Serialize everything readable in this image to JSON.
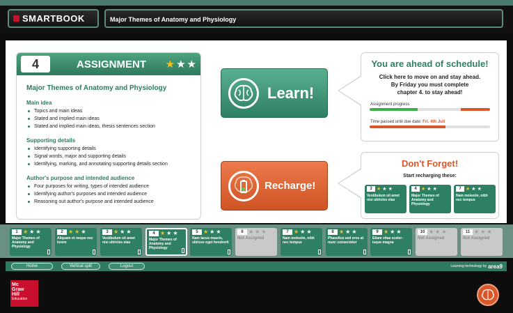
{
  "app": {
    "brand": "SMARTBOOK",
    "chapter_title": "Major Themes of Anatomy and Physiology"
  },
  "assignment": {
    "number": "4",
    "label": "ASSIGNMENT",
    "stars_gold": 1,
    "title": "Major Themes of Anatomy and Physiology",
    "sections": [
      {
        "title": "Main idea",
        "items": [
          "Topics and main ideas",
          "Stated and implied main ideas",
          "Stated and implied main ideas, thesis sentences section"
        ]
      },
      {
        "title": "Supporting details",
        "items": [
          "Identifying supporting details",
          "Signal words, major and supporting details",
          "Identifying, marking, and annotating supporting details section"
        ]
      },
      {
        "title": "Author's purpose and intended audience",
        "items": [
          "Four purposes for writing, types of intended audience",
          "Identifying author's purposes and intended audience",
          "Reasoning out author's purpose and intended audience"
        ]
      }
    ]
  },
  "buttons": {
    "learn": "Learn!",
    "recharge": "Recharge!"
  },
  "schedule": {
    "heading": "You are ahead of schedule!",
    "body_lines": [
      "Click here to move on and stay ahead.",
      "By Friday you must complete",
      "chapter 4. to stay ahead!"
    ],
    "progress_label": "Assignment progress",
    "progress_fraction": 0.4,
    "remaining_fraction": 0.24,
    "time_label": "Time passed until due date:",
    "due_date": "Fri. 4th Jull",
    "time_fraction": 0.63
  },
  "dont_forget": {
    "heading": "Don't Forget!",
    "subheading": "Start recharging these:",
    "tiles": [
      {
        "num": "3",
        "text": "Vestibulum sit amet nisi ultricies elas"
      },
      {
        "num": "4",
        "text": "Major Themes of Anatomy and Physiology"
      },
      {
        "num": "7",
        "text": "Nam molestie, nibh nec tempus"
      }
    ]
  },
  "tiles": [
    {
      "num": "1",
      "text": "Major Themes of Anatomy and Physiology",
      "state": "green",
      "gold": 1
    },
    {
      "num": "2",
      "text": "Aliquam et neque nec lorem",
      "state": "green",
      "gold": 2
    },
    {
      "num": "3",
      "text": "Vestibulum sit amet nisi ultricies elas",
      "state": "green",
      "gold": 1
    },
    {
      "num": "4",
      "text": "Major Themes of Anatomy and Physiology",
      "state": "green",
      "gold": 1,
      "selected": true
    },
    {
      "num": "5",
      "text": "Nam lacus mauris, ultrices eget hendrerit",
      "state": "green",
      "gold": 1
    },
    {
      "num": "6",
      "text": "Not Assigned",
      "state": "grey",
      "gold": 0
    },
    {
      "num": "7",
      "text": "Nam molestie, nibh nec tempus",
      "state": "green",
      "gold": 1
    },
    {
      "num": "8",
      "text": "Phasellus sed eros at nunc consectetur",
      "state": "green",
      "gold": 1
    },
    {
      "num": "9",
      "text": "Etiam vitae sceler-isque magna",
      "state": "green",
      "gold": 1
    },
    {
      "num": "10",
      "text": "Not Assigned",
      "state": "grey",
      "gold": 0
    },
    {
      "num": "11",
      "text": "Not Assigned",
      "state": "grey",
      "gold": 0
    }
  ],
  "nav": {
    "home": "Home",
    "vertical_split": "Vertical split",
    "logout": "Logout",
    "tech_label": "Learning technology by",
    "tech_brand": "area9"
  },
  "publisher": {
    "line1": "Mc",
    "line2": "Graw",
    "line3": "Hill",
    "line4": "Education"
  },
  "colors": {
    "green": "#2e8062",
    "orange": "#d9582b",
    "gold": "#f2c21b",
    "grey_tile": "#c9c9c9"
  },
  "icons": {
    "learn": "brain-icon",
    "recharge": "battery-icon",
    "stars": "star-icon"
  }
}
